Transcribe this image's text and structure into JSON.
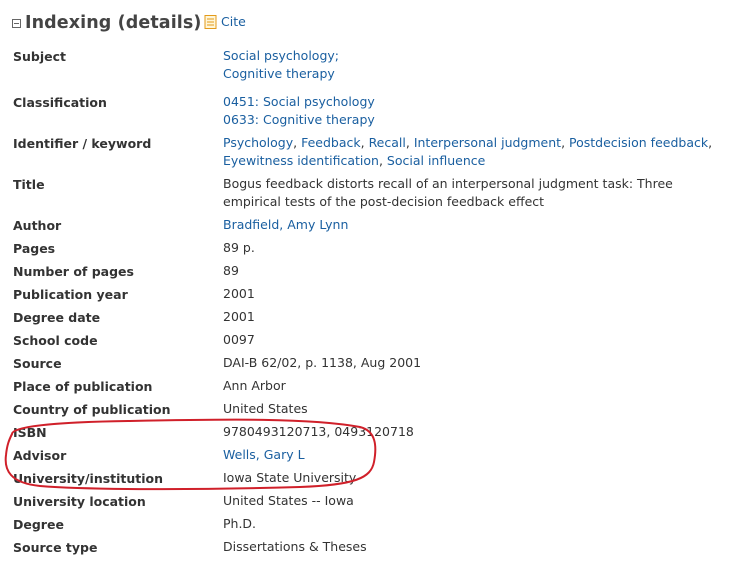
{
  "header": {
    "title": "Indexing (details)",
    "cite_label": "Cite"
  },
  "fields": {
    "subject": {
      "label": "Subject",
      "values": [
        "Social psychology;",
        "Cognitive therapy"
      ]
    },
    "classification": {
      "label": "Classification",
      "values": [
        "0451: Social psychology",
        "0633: Cognitive therapy"
      ]
    },
    "identifier": {
      "label": "Identifier / keyword",
      "values": [
        "Psychology",
        "Feedback",
        "Recall",
        "Interpersonal judgment",
        "Postdecision feedback",
        "Eyewitness identification",
        "Social influence"
      ]
    },
    "title": {
      "label": "Title",
      "lines": [
        "Bogus feedback distorts recall of an interpersonal judgment task: Three",
        "empirical tests of the post-decision feedback effect"
      ]
    },
    "author": {
      "label": "Author",
      "value": "Bradfield, Amy Lynn"
    },
    "pages": {
      "label": "Pages",
      "value": "89 p."
    },
    "number_of_pages": {
      "label": "Number of pages",
      "value": "89"
    },
    "publication_year": {
      "label": "Publication year",
      "value": "2001"
    },
    "degree_date": {
      "label": "Degree date",
      "value": "2001"
    },
    "school_code": {
      "label": "School code",
      "value": "0097"
    },
    "source": {
      "label": "Source",
      "value": "DAI-B 62/02, p. 1138, Aug 2001"
    },
    "place_of_publication": {
      "label": "Place of publication",
      "value": "Ann Arbor"
    },
    "country_of_publication": {
      "label": "Country of publication",
      "value": "United States"
    },
    "isbn": {
      "label": "ISBN",
      "value": "9780493120713, 0493120718"
    },
    "advisor": {
      "label": "Advisor",
      "value": "Wells, Gary L"
    },
    "university": {
      "label": "University/institution",
      "value": "Iowa State University"
    },
    "university_location": {
      "label": "University location",
      "value": "United States -- Iowa"
    },
    "degree": {
      "label": "Degree",
      "value": "Ph.D."
    },
    "source_type": {
      "label": "Source type",
      "value": "Dissertations & Theses"
    }
  },
  "colors": {
    "link": "#1a5fa0",
    "annotation": "#d0202a",
    "text": "#333333"
  }
}
